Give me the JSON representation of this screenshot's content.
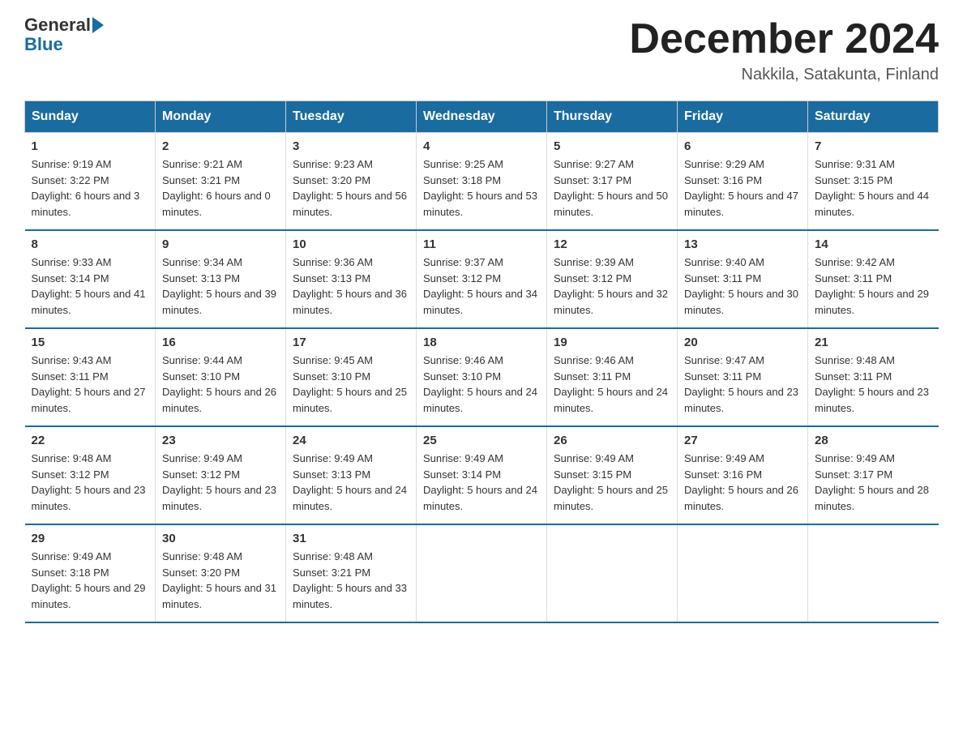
{
  "header": {
    "logo_general": "General",
    "logo_blue": "Blue",
    "title": "December 2024",
    "subtitle": "Nakkila, Satakunta, Finland"
  },
  "weekdays": [
    "Sunday",
    "Monday",
    "Tuesday",
    "Wednesday",
    "Thursday",
    "Friday",
    "Saturday"
  ],
  "weeks": [
    [
      {
        "day": "1",
        "sunrise": "9:19 AM",
        "sunset": "3:22 PM",
        "daylight": "6 hours and 3 minutes."
      },
      {
        "day": "2",
        "sunrise": "9:21 AM",
        "sunset": "3:21 PM",
        "daylight": "6 hours and 0 minutes."
      },
      {
        "day": "3",
        "sunrise": "9:23 AM",
        "sunset": "3:20 PM",
        "daylight": "5 hours and 56 minutes."
      },
      {
        "day": "4",
        "sunrise": "9:25 AM",
        "sunset": "3:18 PM",
        "daylight": "5 hours and 53 minutes."
      },
      {
        "day": "5",
        "sunrise": "9:27 AM",
        "sunset": "3:17 PM",
        "daylight": "5 hours and 50 minutes."
      },
      {
        "day": "6",
        "sunrise": "9:29 AM",
        "sunset": "3:16 PM",
        "daylight": "5 hours and 47 minutes."
      },
      {
        "day": "7",
        "sunrise": "9:31 AM",
        "sunset": "3:15 PM",
        "daylight": "5 hours and 44 minutes."
      }
    ],
    [
      {
        "day": "8",
        "sunrise": "9:33 AM",
        "sunset": "3:14 PM",
        "daylight": "5 hours and 41 minutes."
      },
      {
        "day": "9",
        "sunrise": "9:34 AM",
        "sunset": "3:13 PM",
        "daylight": "5 hours and 39 minutes."
      },
      {
        "day": "10",
        "sunrise": "9:36 AM",
        "sunset": "3:13 PM",
        "daylight": "5 hours and 36 minutes."
      },
      {
        "day": "11",
        "sunrise": "9:37 AM",
        "sunset": "3:12 PM",
        "daylight": "5 hours and 34 minutes."
      },
      {
        "day": "12",
        "sunrise": "9:39 AM",
        "sunset": "3:12 PM",
        "daylight": "5 hours and 32 minutes."
      },
      {
        "day": "13",
        "sunrise": "9:40 AM",
        "sunset": "3:11 PM",
        "daylight": "5 hours and 30 minutes."
      },
      {
        "day": "14",
        "sunrise": "9:42 AM",
        "sunset": "3:11 PM",
        "daylight": "5 hours and 29 minutes."
      }
    ],
    [
      {
        "day": "15",
        "sunrise": "9:43 AM",
        "sunset": "3:11 PM",
        "daylight": "5 hours and 27 minutes."
      },
      {
        "day": "16",
        "sunrise": "9:44 AM",
        "sunset": "3:10 PM",
        "daylight": "5 hours and 26 minutes."
      },
      {
        "day": "17",
        "sunrise": "9:45 AM",
        "sunset": "3:10 PM",
        "daylight": "5 hours and 25 minutes."
      },
      {
        "day": "18",
        "sunrise": "9:46 AM",
        "sunset": "3:10 PM",
        "daylight": "5 hours and 24 minutes."
      },
      {
        "day": "19",
        "sunrise": "9:46 AM",
        "sunset": "3:11 PM",
        "daylight": "5 hours and 24 minutes."
      },
      {
        "day": "20",
        "sunrise": "9:47 AM",
        "sunset": "3:11 PM",
        "daylight": "5 hours and 23 minutes."
      },
      {
        "day": "21",
        "sunrise": "9:48 AM",
        "sunset": "3:11 PM",
        "daylight": "5 hours and 23 minutes."
      }
    ],
    [
      {
        "day": "22",
        "sunrise": "9:48 AM",
        "sunset": "3:12 PM",
        "daylight": "5 hours and 23 minutes."
      },
      {
        "day": "23",
        "sunrise": "9:49 AM",
        "sunset": "3:12 PM",
        "daylight": "5 hours and 23 minutes."
      },
      {
        "day": "24",
        "sunrise": "9:49 AM",
        "sunset": "3:13 PM",
        "daylight": "5 hours and 24 minutes."
      },
      {
        "day": "25",
        "sunrise": "9:49 AM",
        "sunset": "3:14 PM",
        "daylight": "5 hours and 24 minutes."
      },
      {
        "day": "26",
        "sunrise": "9:49 AM",
        "sunset": "3:15 PM",
        "daylight": "5 hours and 25 minutes."
      },
      {
        "day": "27",
        "sunrise": "9:49 AM",
        "sunset": "3:16 PM",
        "daylight": "5 hours and 26 minutes."
      },
      {
        "day": "28",
        "sunrise": "9:49 AM",
        "sunset": "3:17 PM",
        "daylight": "5 hours and 28 minutes."
      }
    ],
    [
      {
        "day": "29",
        "sunrise": "9:49 AM",
        "sunset": "3:18 PM",
        "daylight": "5 hours and 29 minutes."
      },
      {
        "day": "30",
        "sunrise": "9:48 AM",
        "sunset": "3:20 PM",
        "daylight": "5 hours and 31 minutes."
      },
      {
        "day": "31",
        "sunrise": "9:48 AM",
        "sunset": "3:21 PM",
        "daylight": "5 hours and 33 minutes."
      },
      null,
      null,
      null,
      null
    ]
  ]
}
